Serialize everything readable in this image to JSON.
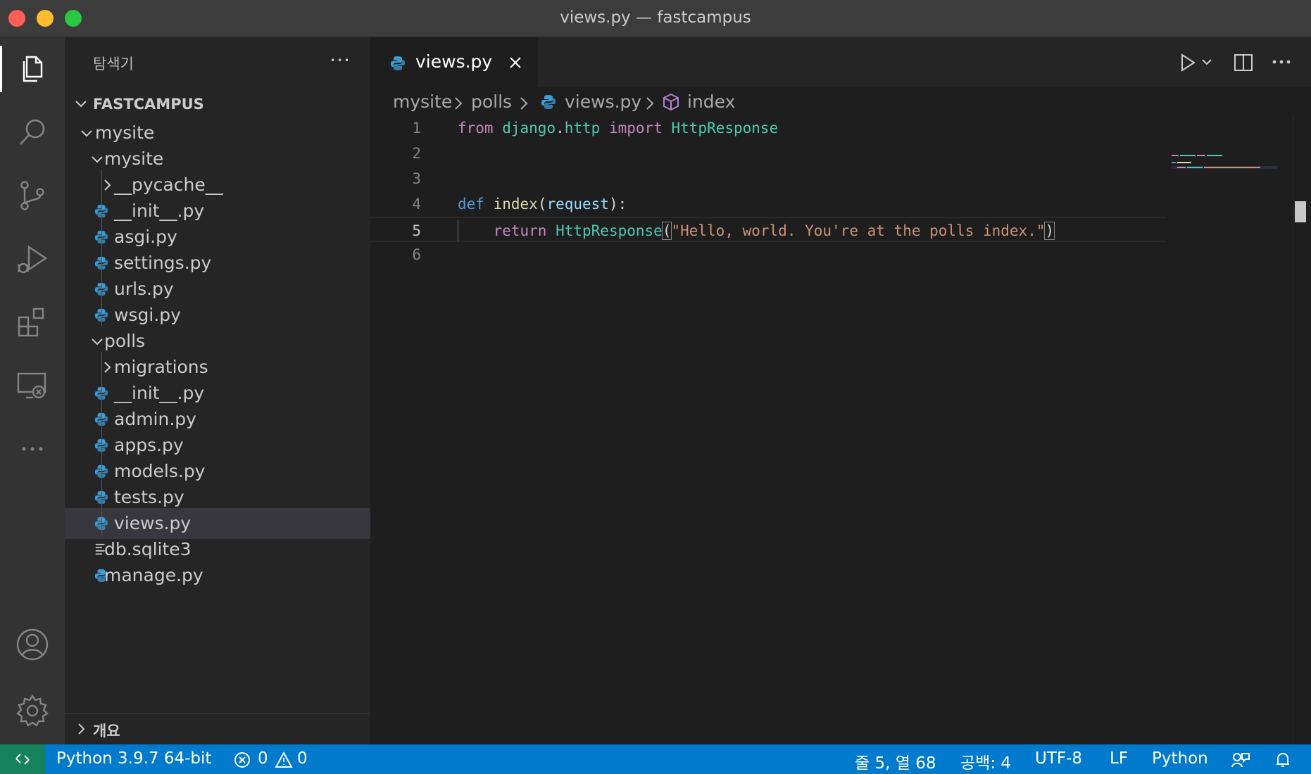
{
  "window": {
    "title": "views.py — fastcampus"
  },
  "activity_bar": {
    "items": [
      "files-icon",
      "search-icon",
      "source-control-icon",
      "run-debug-icon",
      "extensions-icon",
      "remote-explorer-icon",
      "more-icon",
      "account-icon",
      "gear-icon"
    ]
  },
  "sidebar": {
    "title": "탐색기",
    "more": "···",
    "root": "FASTCAMPUS",
    "tree": [
      {
        "label": "mysite",
        "kind": "folder",
        "depth": 0,
        "expanded": true
      },
      {
        "label": "mysite",
        "kind": "folder",
        "depth": 1,
        "expanded": true
      },
      {
        "label": "__pycache__",
        "kind": "folder",
        "depth": 2,
        "expanded": false
      },
      {
        "label": "__init__.py",
        "kind": "python",
        "depth": 2
      },
      {
        "label": "asgi.py",
        "kind": "python",
        "depth": 2
      },
      {
        "label": "settings.py",
        "kind": "python",
        "depth": 2
      },
      {
        "label": "urls.py",
        "kind": "python",
        "depth": 2
      },
      {
        "label": "wsgi.py",
        "kind": "python",
        "depth": 2
      },
      {
        "label": "polls",
        "kind": "folder",
        "depth": 1,
        "expanded": true
      },
      {
        "label": "migrations",
        "kind": "folder",
        "depth": 2,
        "expanded": false
      },
      {
        "label": "__init__.py",
        "kind": "python",
        "depth": 2
      },
      {
        "label": "admin.py",
        "kind": "python",
        "depth": 2
      },
      {
        "label": "apps.py",
        "kind": "python",
        "depth": 2
      },
      {
        "label": "models.py",
        "kind": "python",
        "depth": 2
      },
      {
        "label": "tests.py",
        "kind": "python",
        "depth": 2
      },
      {
        "label": "views.py",
        "kind": "python",
        "depth": 2,
        "selected": true
      },
      {
        "label": "db.sqlite3",
        "kind": "file",
        "depth": 1
      },
      {
        "label": "manage.py",
        "kind": "python",
        "depth": 1
      }
    ],
    "outline": "개요"
  },
  "editor": {
    "tab": {
      "label": "views.py",
      "close": "close-icon"
    },
    "breadcrumbs": [
      "mysite",
      "polls",
      "views.py",
      "index"
    ],
    "lines": [
      {
        "n": "1",
        "tokens": [
          [
            "from",
            "kw-ctrl"
          ],
          [
            " ",
            ""
          ],
          [
            "django",
            "mod"
          ],
          [
            ".",
            ""
          ],
          [
            "http",
            "mod"
          ],
          [
            " ",
            ""
          ],
          [
            "import",
            "kw-ctrl"
          ],
          [
            " ",
            ""
          ],
          [
            "HttpResponse",
            "cls"
          ]
        ]
      },
      {
        "n": "2",
        "tokens": []
      },
      {
        "n": "3",
        "tokens": []
      },
      {
        "n": "4",
        "tokens": [
          [
            "def",
            "kw"
          ],
          [
            " ",
            ""
          ],
          [
            "index",
            "fn"
          ],
          [
            "(",
            ""
          ],
          [
            "request",
            "param"
          ],
          [
            "):",
            ""
          ]
        ]
      },
      {
        "n": "5",
        "current": true,
        "tokens": [
          [
            "    ",
            ""
          ],
          [
            "return",
            "kw-ctrl"
          ],
          [
            " ",
            ""
          ],
          [
            "HttpResponse",
            "cls"
          ],
          [
            "(",
            "br"
          ],
          [
            "\"Hello, world. You're at the polls index.\"",
            "str"
          ],
          [
            ")",
            "br"
          ]
        ]
      },
      {
        "n": "6",
        "tokens": []
      }
    ]
  },
  "statusbar": {
    "interpreter": "Python 3.9.7 64-bit",
    "errors": "0",
    "warnings": "0",
    "position": "줄 5, 열 68",
    "spaces": "공백: 4",
    "encoding": "UTF-8",
    "eol": "LF",
    "language": "Python"
  },
  "colors": {
    "statusbar": "#007acc",
    "remote": "#16825d",
    "python_icon": "#3b9cd6"
  }
}
